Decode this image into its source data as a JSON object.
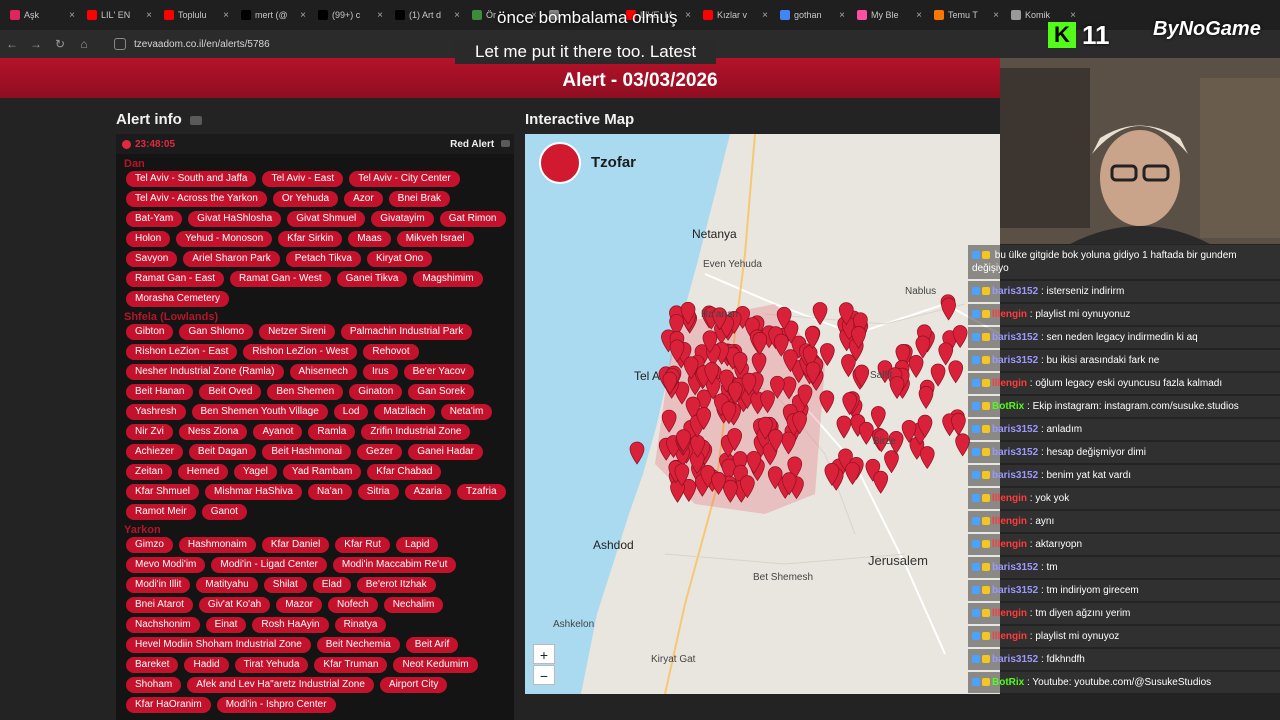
{
  "browser": {
    "tabs": [
      {
        "label": "Aşk",
        "color": "#e0245e"
      },
      {
        "label": "LIL' EN",
        "color": "#ff0000"
      },
      {
        "label": "Toplulu",
        "color": "#ff0000"
      },
      {
        "label": "mert (@",
        "color": "#000000"
      },
      {
        "label": "(99+) c",
        "color": "#000000"
      },
      {
        "label": "(1) Art d",
        "color": "#000000"
      },
      {
        "label": "Ör",
        "color": "#3c8c3c"
      },
      {
        "label": "",
        "color": "#888888"
      },
      {
        "label": "LIVE: M",
        "color": "#ff0000"
      },
      {
        "label": "Kızlar v",
        "color": "#ff0000"
      },
      {
        "label": "gothan",
        "color": "#4285f4"
      },
      {
        "label": "My Ble",
        "color": "#ff4fa3"
      },
      {
        "label": "Temu T",
        "color": "#fb7701"
      },
      {
        "label": "Komik",
        "color": "#999999"
      }
    ],
    "url": "tzevaadom.co.il/en/alerts/5786"
  },
  "header": {
    "alert_title": "Alert - 03/03/2026"
  },
  "alert_info": {
    "heading": "Alert info",
    "time": "23:48:05",
    "type": "Red Alert",
    "regions": [
      {
        "name": "Dan",
        "places": [
          "Tel Aviv - South and Jaffa",
          "Tel Aviv - East",
          "Tel Aviv - City Center",
          "Tel Aviv - Across the Yarkon",
          "Or Yehuda",
          "Azor",
          "Bnei Brak",
          "Bat-Yam",
          "Givat HaShlosha",
          "Givat Shmuel",
          "Givatayim",
          "Gat Rimon",
          "Holon",
          "Yehud - Monoson",
          "Kfar Sirkin",
          "Maas",
          "Mikveh Israel",
          "Savyon",
          "Ariel Sharon Park",
          "Petach Tikva",
          "Kiryat Ono",
          "Ramat Gan - East",
          "Ramat Gan - West",
          "Ganei Tikva",
          "Magshimim",
          "Morasha Cemetery"
        ]
      },
      {
        "name": "Shfela (Lowlands)",
        "places": [
          "Gibton",
          "Gan Shlomo",
          "Netzer Sireni",
          "Palmachin Industrial Park",
          "Rishon LeZion - East",
          "Rishon LeZion - West",
          "Rehovot",
          "Nesher Industrial Zone (Ramla)",
          "Ahisemech",
          "Irus",
          "Be'er Yacov",
          "Beit Hanan",
          "Beit Oved",
          "Ben Shemen",
          "Ginaton",
          "Gan Sorek",
          "Yashresh",
          "Ben Shemen Youth Village",
          "Lod",
          "Matzliach",
          "Neta'im",
          "Nir Zvi",
          "Ness Ziona",
          "Ayanot",
          "Ramla",
          "Zrifin Industrial Zone",
          "Achiezer",
          "Beit Dagan",
          "Beit Hashmonai",
          "Gezer",
          "Ganei Hadar",
          "Zeitan",
          "Hemed",
          "Yagel",
          "Yad Rambam",
          "Kfar Chabad",
          "Kfar Shmuel",
          "Mishmar HaShiva",
          "Na'an",
          "Sitria",
          "Azaria",
          "Tzafria",
          "Ramot Meir",
          "Ganot"
        ]
      },
      {
        "name": "Yarkon",
        "places": [
          "Gimzo",
          "Hashmonaim",
          "Kfar Daniel",
          "Kfar Rut",
          "Lapid",
          "Mevo Modi'im",
          "Modi'in - Ligad Center",
          "Modi'in Maccabim Re'ut",
          "Modi'in Illit",
          "Matityahu",
          "Shilat",
          "Elad",
          "Be'erot Itzhak",
          "Bnei Atarot",
          "Giv'at Ko'ah",
          "Mazor",
          "Nofech",
          "Nechalim",
          "Nachshonim",
          "Einat",
          "Rosh HaAyin",
          "Rinatya",
          "Hevel Modiin Shoham Industrial Zone",
          "Beit Nechemia",
          "Beit Arif",
          "Bareket",
          "Hadid",
          "Tirat Yehuda",
          "Kfar Truman",
          "Neot Kedumim",
          "Shoham",
          "Afek and Lev Ha\"aretz Industrial Zone",
          "Airport City",
          "Kfar HaOranim",
          "Modi'in - Ishpro Center"
        ]
      }
    ]
  },
  "map": {
    "heading": "Interactive Map",
    "brand": "Tzofar",
    "zoom_in": "+",
    "zoom_out": "−",
    "places": {
      "netanya": "Netanya",
      "even_yehuda": "Even Yehuda",
      "nablus": "Nablus",
      "tel_aviv": "Tel A",
      "salfit": "Salfit",
      "birzeit": "Birze",
      "ashdod": "Ashdod",
      "jerusalem": "Jerusalem",
      "beit_shemesh": "Bet Shemesh",
      "ashkelon": "Ashkelon",
      "kiryat_gat": "Kiryat Gat",
      "raanana": "Ra'anan"
    }
  },
  "subtitles": {
    "line1": "önce bombalama olmuş",
    "line2": "Let me put it there too. Latest"
  },
  "stream": {
    "viewer_count": "11",
    "channel_brand": "ByNoGame",
    "chat": [
      {
        "user": "",
        "text": "bu ülke gitgide bok yoluna gidiyo 1 haftada bir gundem değişiyo",
        "color": "#ff5a5a"
      },
      {
        "user": "baris3152",
        "text": ": isterseniz indirirm",
        "color": "#9a9aff"
      },
      {
        "user": "lllengin",
        "text": ": playlist mi oynuyonuz",
        "color": "#ff3b3b"
      },
      {
        "user": "baris3152",
        "text": ": sen neden legacy indirmedin ki aq",
        "color": "#9a9aff"
      },
      {
        "user": "baris3152",
        "text": ": bu ikisi arasındaki fark ne",
        "color": "#9a9aff"
      },
      {
        "user": "lllengin",
        "text": ": oğlum legacy eski oyuncusu fazla kalmadı",
        "color": "#ff3b3b"
      },
      {
        "user": "BotRix",
        "text": ": Ekip instagram: instagram.com/susuke.studios",
        "color": "#53fc18"
      },
      {
        "user": "baris3152",
        "text": ": anladım",
        "color": "#9a9aff"
      },
      {
        "user": "baris3152",
        "text": ": hesap değişmiyor dimi",
        "color": "#9a9aff"
      },
      {
        "user": "baris3152",
        "text": ": benim yat kat vardı",
        "color": "#9a9aff"
      },
      {
        "user": "lllengin",
        "text": ": yok yok",
        "color": "#ff3b3b"
      },
      {
        "user": "lllengin",
        "text": ": aynı",
        "color": "#ff3b3b"
      },
      {
        "user": "lllengin",
        "text": ": aktarıyopn",
        "color": "#ff3b3b"
      },
      {
        "user": "baris3152",
        "text": ": tm",
        "color": "#9a9aff"
      },
      {
        "user": "baris3152",
        "text": ": tm indiriyom girecem",
        "color": "#9a9aff"
      },
      {
        "user": "lllengin",
        "text": ": tm diyen ağzını yerim",
        "color": "#ff3b3b"
      },
      {
        "user": "lllengin",
        "text": ": playlist mi oynuyoz",
        "color": "#ff3b3b"
      },
      {
        "user": "baris3152",
        "text": ": fdkhndfh",
        "color": "#9a9aff"
      },
      {
        "user": "BotRix",
        "text": ": Youtube: youtube.com/@SusukeStudios",
        "color": "#53fc18"
      }
    ]
  }
}
